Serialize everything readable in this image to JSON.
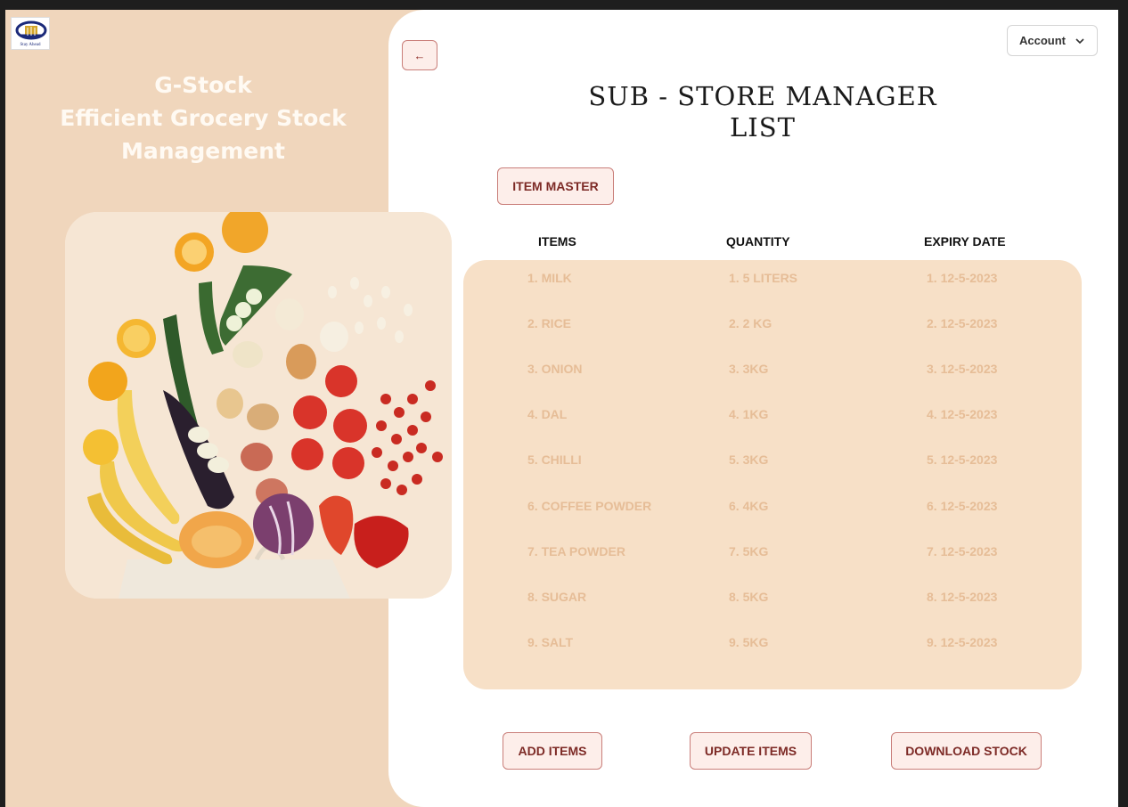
{
  "brand": {
    "logo_tagline": "Stay Ahead",
    "hero_lines": [
      "G-Stock",
      "Efficient Grocery Stock",
      "Management"
    ]
  },
  "header": {
    "back_icon": "arrow-left-icon",
    "account_label": "Account",
    "account_icon": "chevron-down-icon"
  },
  "page": {
    "title_lines": [
      "SUB - STORE MANAGER",
      "LIST"
    ],
    "item_master_label": "ITEM MASTER"
  },
  "table": {
    "columns": [
      "ITEMS",
      "QUANTITY",
      "EXPIRY DATE"
    ],
    "rows": [
      {
        "item": "1. MILK",
        "quantity": "1. 5 LITERS",
        "expiry": "1. 12-5-2023"
      },
      {
        "item": "2. RICE",
        "quantity": "2. 2 KG",
        "expiry": "2. 12-5-2023"
      },
      {
        "item": "3. ONION",
        "quantity": "3. 3KG",
        "expiry": "3. 12-5-2023"
      },
      {
        "item": "4. DAL",
        "quantity": "4. 1KG",
        "expiry": "4. 12-5-2023"
      },
      {
        "item": "5. CHILLI",
        "quantity": "5. 3KG",
        "expiry": "5. 12-5-2023"
      },
      {
        "item": "6. COFFEE POWDER",
        "quantity": "6. 4KG",
        "expiry": "6. 12-5-2023"
      },
      {
        "item": "7. TEA POWDER",
        "quantity": "7. 5KG",
        "expiry": "7. 12-5-2023"
      },
      {
        "item": "8. SUGAR",
        "quantity": "8. 5KG",
        "expiry": "8. 12-5-2023"
      },
      {
        "item": "9. SALT",
        "quantity": "9. 5KG",
        "expiry": "9. 12-5-2023"
      }
    ]
  },
  "actions": {
    "add_label": "ADD ITEMS",
    "update_label": "UPDATE ITEMS",
    "download_label": "DOWNLOAD STOCK"
  },
  "colors": {
    "left_panel": "#f0d6bc",
    "table_card": "#f7e0c7",
    "table_text": "#e6bd97",
    "button_fill": "#fdeeea",
    "button_border": "#c97e79",
    "button_text": "#7d2a26"
  }
}
